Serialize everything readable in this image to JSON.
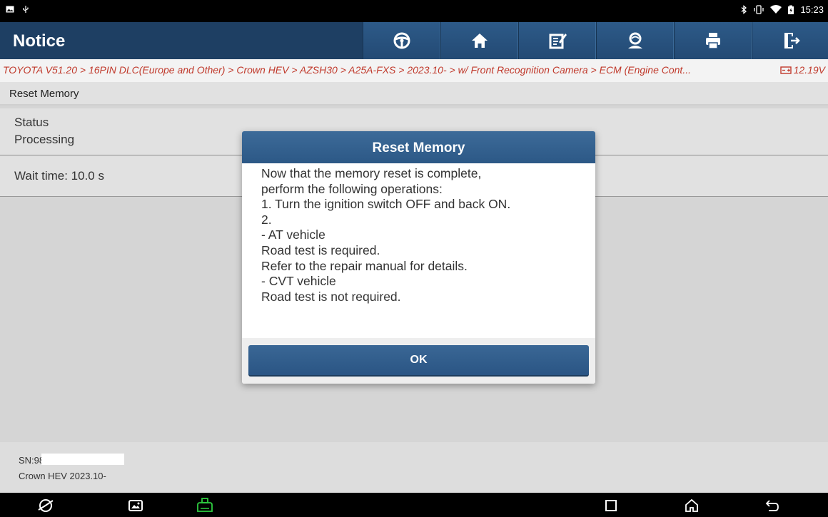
{
  "status_bar": {
    "time": "15:23",
    "left_icons": [
      "image-icon",
      "usb-icon"
    ],
    "right_icons": [
      "bluetooth-icon",
      "vibrate-icon",
      "wifi-icon",
      "battery-icon"
    ]
  },
  "header": {
    "title": "Notice",
    "toolbar": [
      "steering-wheel-icon",
      "home-icon",
      "edit-report-icon",
      "remote-support-icon",
      "print-icon",
      "exit-icon"
    ]
  },
  "breadcrumb": {
    "path": "TOYOTA V51.20 > 16PIN DLC(Europe and Other) > Crown HEV > AZSH30 > A25A-FXS > 2023.10- > w/ Front Recognition Camera > ECM (Engine Cont...",
    "voltage": "12.19V"
  },
  "main": {
    "section_title": "Reset Memory",
    "status_label": "Status",
    "status_value": "Processing",
    "wait_time": "Wait time: 10.0 s"
  },
  "footer": {
    "sn": "SN:98",
    "model": "Crown HEV 2023.10-"
  },
  "dialog": {
    "title": "Reset Memory",
    "lines": [
      "Now that the memory reset is complete,",
      "perform the following operations:",
      "1. Turn the ignition switch OFF and back ON.",
      "2.",
      "- AT vehicle",
      "Road test is required.",
      "Refer to the repair manual for details.",
      "- CVT vehicle",
      "Road test is not required."
    ],
    "ok_label": "OK"
  },
  "navbar": {
    "icons": [
      "browser-icon",
      "gallery-icon",
      "vci-icon",
      "recents-icon",
      "home-icon",
      "back-icon"
    ]
  },
  "colors": {
    "header_bg": "#1e3f63",
    "breadcrumb_text": "#c0392b",
    "dialog_title_bg": "#2f5b88",
    "vci_green": "#2ecc40"
  }
}
